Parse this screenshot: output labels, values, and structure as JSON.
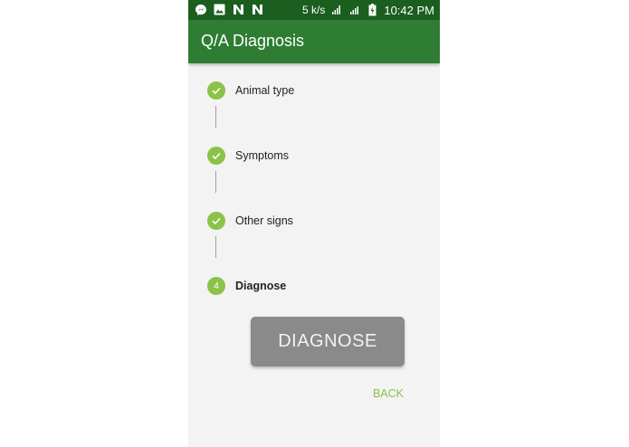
{
  "status_bar": {
    "net_speed": "5 k/s",
    "time": "10:42 PM",
    "icons": [
      "messenger-icon",
      "image-icon",
      "n-icon",
      "n-icon",
      "wifi-icon",
      "signal-icon",
      "battery-icon"
    ]
  },
  "app_bar": {
    "title": "Q/A Diagnosis"
  },
  "steps": [
    {
      "label": "Animal type",
      "state": "done"
    },
    {
      "label": "Symptoms",
      "state": "done"
    },
    {
      "label": "Other signs",
      "state": "done"
    },
    {
      "label": "Diagnose",
      "state": "active",
      "number": "4"
    }
  ],
  "actions": {
    "diagnose_label": "DIAGNOSE",
    "back_label": "BACK"
  },
  "colors": {
    "status_bar": "#1b5e20",
    "app_bar": "#2e7d32",
    "accent": "#8bc34a",
    "button": "#8a8a8a"
  }
}
